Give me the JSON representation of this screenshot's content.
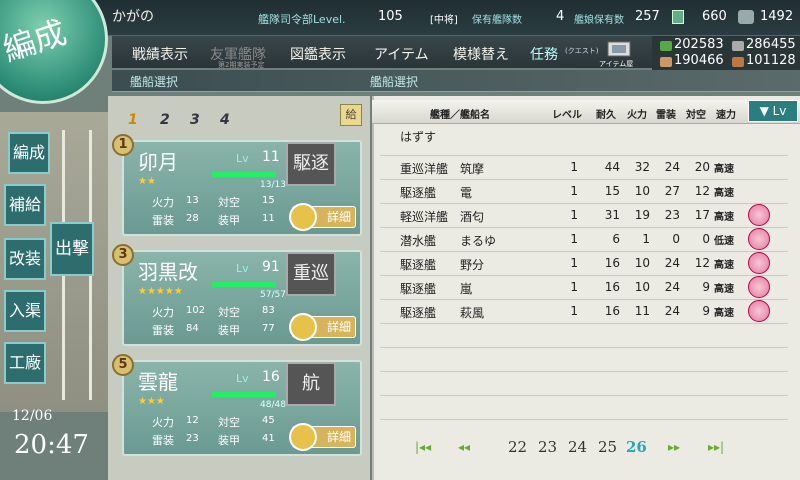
{
  "top": {
    "admiral_name": "かがの",
    "hq_label": "艦隊司令部Level.",
    "hq_level": "105",
    "rank": "[中将]",
    "fleet_label": "保有艦隊数",
    "fleet_count": "4",
    "girls_label": "艦娘保有数",
    "girls_count": "257",
    "bucket": "660",
    "screws": "1492"
  },
  "menu": {
    "items": [
      "戦績表示",
      "友軍艦隊",
      "図鑑表示",
      "アイテム",
      "模様替え",
      "任務"
    ],
    "friend_sub": "第2期実装予定",
    "quest_sub": "(クエスト)",
    "furniture_label": "アイテム屋"
  },
  "resources": {
    "fuel": "202583",
    "ammo": "190466",
    "steel": "286455",
    "bauxite": "101128"
  },
  "header": {
    "emblem": "編成",
    "left_sub": "艦船選択",
    "right_sub": "艦船選択"
  },
  "nav": {
    "organize": "編成",
    "supply": "補給",
    "remodel": "改装",
    "dock": "入渠",
    "arsenal": "工廠",
    "sortie": "出撃",
    "date": "12/06",
    "time": "20:47"
  },
  "fleet": {
    "tabs": [
      "1",
      "2",
      "3",
      "4"
    ],
    "supply_icon": "給",
    "slots": [
      {
        "num": "1",
        "name": "卯月",
        "lv_label": "Lv",
        "lv": "11",
        "hp": "13/13",
        "hp_frac": 1.0,
        "stars": "★★",
        "type": "駆逐",
        "firepower_label": "火力",
        "firepower": "13",
        "aa_label": "対空",
        "aa": "15",
        "torpedo_label": "雷装",
        "torpedo": "28",
        "armor_label": "装甲",
        "armor": "11",
        "detail": "詳細"
      },
      {
        "num": "3",
        "name": "羽黒改",
        "lv_label": "Lv",
        "lv": "91",
        "hp": "57/57",
        "hp_frac": 1.0,
        "stars": "★★★★★",
        "type": "重巡",
        "firepower_label": "火力",
        "firepower": "102",
        "aa_label": "対空",
        "aa": "83",
        "torpedo_label": "雷装",
        "torpedo": "84",
        "armor_label": "装甲",
        "armor": "77",
        "detail": "詳細"
      },
      {
        "num": "5",
        "name": "雲龍",
        "lv_label": "Lv",
        "lv": "16",
        "hp": "48/48",
        "hp_frac": 1.0,
        "stars": "★★★",
        "type": "航",
        "firepower_label": "火力",
        "firepower": "12",
        "aa_label": "対空",
        "aa": "45",
        "torpedo_label": "雷装",
        "torpedo": "23",
        "armor_label": "装甲",
        "armor": "41",
        "detail": "詳細"
      }
    ]
  },
  "list": {
    "headers": [
      "艦種／艦船名",
      "レベル",
      "耐久",
      "火力",
      "雷装",
      "対空",
      "速力"
    ],
    "sort_label": "Lv",
    "remove": "はずす",
    "rows": [
      {
        "type": "重巡洋艦",
        "name": "筑摩",
        "lv": "1",
        "hp": "44",
        "fp": "32",
        "tp": "24",
        "aa": "20",
        "speed": "高速",
        "locked": false
      },
      {
        "type": "駆逐艦",
        "name": "電",
        "lv": "1",
        "hp": "15",
        "fp": "10",
        "tp": "27",
        "aa": "12",
        "speed": "高速",
        "locked": false
      },
      {
        "type": "軽巡洋艦",
        "name": "酒匂",
        "lv": "1",
        "hp": "31",
        "fp": "19",
        "tp": "23",
        "aa": "17",
        "speed": "高速",
        "locked": true
      },
      {
        "type": "潜水艦",
        "name": "まるゆ",
        "lv": "1",
        "hp": "6",
        "fp": "1",
        "tp": "0",
        "aa": "0",
        "speed": "低速",
        "locked": true
      },
      {
        "type": "駆逐艦",
        "name": "野分",
        "lv": "1",
        "hp": "16",
        "fp": "10",
        "tp": "24",
        "aa": "12",
        "speed": "高速",
        "locked": true
      },
      {
        "type": "駆逐艦",
        "name": "嵐",
        "lv": "1",
        "hp": "16",
        "fp": "10",
        "tp": "24",
        "aa": "9",
        "speed": "高速",
        "locked": true
      },
      {
        "type": "駆逐艦",
        "name": "萩風",
        "lv": "1",
        "hp": "16",
        "fp": "11",
        "tp": "24",
        "aa": "9",
        "speed": "高速",
        "locked": true
      }
    ],
    "pages": [
      "22",
      "23",
      "24",
      "25",
      "26"
    ],
    "current_page": "26"
  }
}
